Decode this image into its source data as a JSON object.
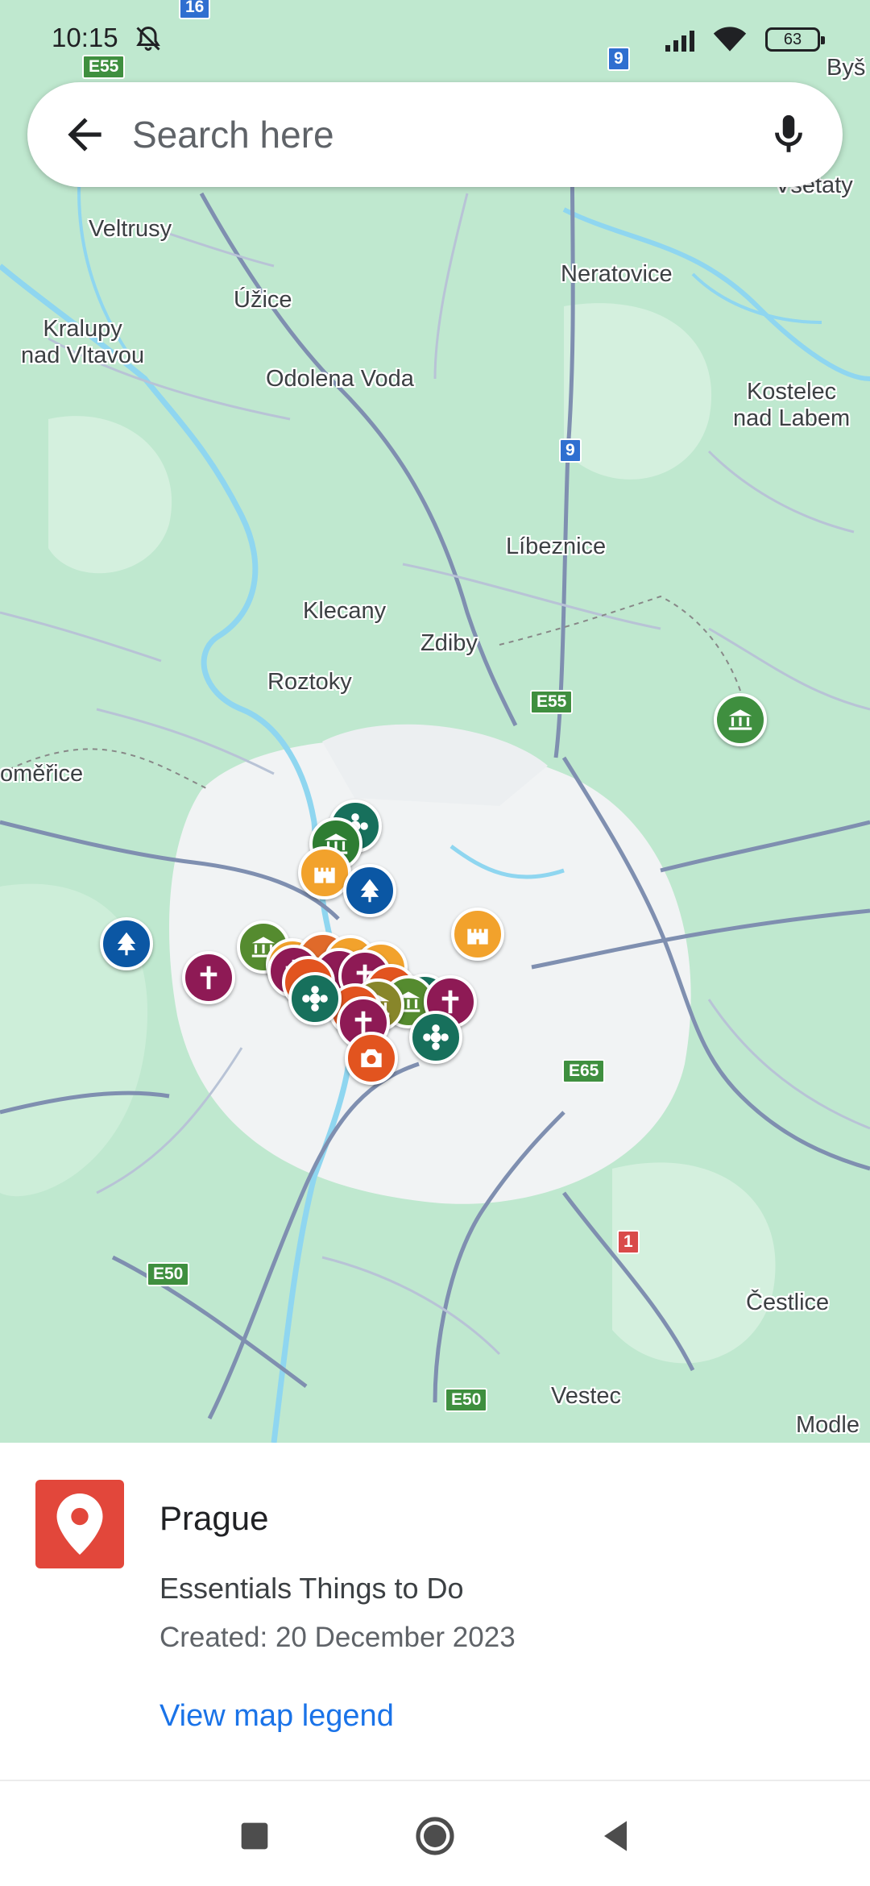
{
  "status_bar": {
    "time": "10:15",
    "battery": "63"
  },
  "search": {
    "placeholder": "Search here"
  },
  "map": {
    "places": [
      "Veltrusy",
      "Úžice",
      "Neratovice",
      "Kralupy\nnad Vltavou",
      "Odolena Voda",
      "Kostelec\nnad Labem",
      "Líbeznice",
      "Klecany",
      "Zdiby",
      "Roztoky",
      "oměřice",
      "Čestlice",
      "Vestec",
      "Modle",
      "Všetaty",
      "Byš"
    ],
    "road_shields": [
      "E55",
      "16",
      "9",
      "9",
      "E55",
      "E65",
      "1",
      "E50",
      "E50"
    ]
  },
  "sheet": {
    "title": "Prague",
    "subtitle": "Essentials Things to Do",
    "created": "Created: 20 December 2023",
    "legend_link": "View map legend"
  },
  "icons": [
    "back-arrow-icon",
    "microphone-icon",
    "map-pin-icon",
    "square-icon",
    "circle-home-icon",
    "triangle-back-icon"
  ]
}
